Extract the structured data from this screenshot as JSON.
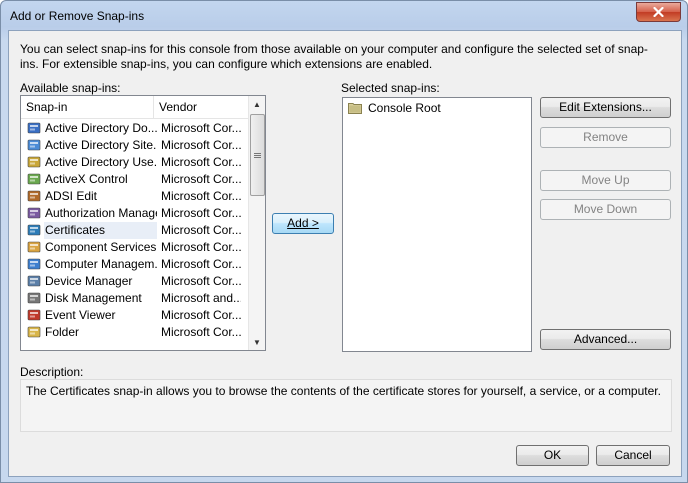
{
  "window": {
    "title": "Add or Remove Snap-ins"
  },
  "intro_text": "You can select snap-ins for this console from those available on your computer and configure the selected set of snap-ins. For extensible snap-ins, you can configure which extensions are enabled.",
  "available": {
    "label": "Available snap-ins:",
    "columns": [
      "Snap-in",
      "Vendor"
    ],
    "rows": [
      {
        "name": "Active Directory Do...",
        "vendor": "Microsoft Cor...",
        "icon": "active-directory-domains-icon"
      },
      {
        "name": "Active Directory Site...",
        "vendor": "Microsoft Cor...",
        "icon": "active-directory-sites-icon"
      },
      {
        "name": "Active Directory Use...",
        "vendor": "Microsoft Cor...",
        "icon": "active-directory-users-icon"
      },
      {
        "name": "ActiveX Control",
        "vendor": "Microsoft Cor...",
        "icon": "activex-control-icon"
      },
      {
        "name": "ADSI Edit",
        "vendor": "Microsoft Cor...",
        "icon": "adsi-edit-icon"
      },
      {
        "name": "Authorization Manager",
        "vendor": "Microsoft Cor...",
        "icon": "authorization-manager-icon"
      },
      {
        "name": "Certificates",
        "vendor": "Microsoft Cor...",
        "icon": "certificates-icon",
        "selected": true
      },
      {
        "name": "Component Services",
        "vendor": "Microsoft Cor...",
        "icon": "component-services-icon"
      },
      {
        "name": "Computer Managem...",
        "vendor": "Microsoft Cor...",
        "icon": "computer-management-icon"
      },
      {
        "name": "Device Manager",
        "vendor": "Microsoft Cor...",
        "icon": "device-manager-icon"
      },
      {
        "name": "Disk Management",
        "vendor": "Microsoft and...",
        "icon": "disk-management-icon"
      },
      {
        "name": "Event Viewer",
        "vendor": "Microsoft Cor...",
        "icon": "event-viewer-icon"
      },
      {
        "name": "Folder",
        "vendor": "Microsoft Cor...",
        "icon": "folder-icon"
      }
    ]
  },
  "selected": {
    "label": "Selected snap-ins:",
    "items": [
      "Console Root"
    ]
  },
  "buttons": {
    "add": "Add >",
    "edit_extensions": "Edit Extensions...",
    "remove": "Remove",
    "move_up": "Move Up",
    "move_down": "Move Down",
    "advanced": "Advanced...",
    "ok": "OK",
    "cancel": "Cancel"
  },
  "description": {
    "label": "Description:",
    "text": "The Certificates snap-in allows you to browse the contents of the certificate stores for yourself, a service, or a computer."
  },
  "colors": {
    "title_bar": "#c3d6ef",
    "close_button": "#c94a33",
    "selected_row": "#e8eef7",
    "dialog_bg": "#f0f0f0"
  }
}
